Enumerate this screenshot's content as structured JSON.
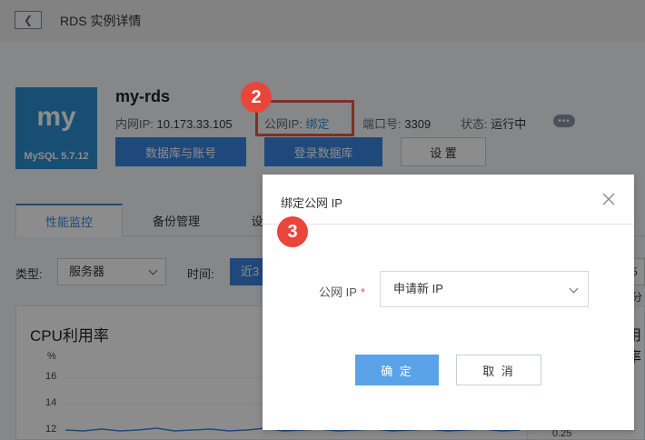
{
  "header": {
    "back_icon": "chevron-left-icon",
    "title": "RDS 实例详情"
  },
  "instance": {
    "logo_text": "my",
    "logo_version": "MySQL 5.7.12",
    "name": "my-rds",
    "intranet_label": "内网IP:",
    "intranet_value": "10.173.33.105",
    "public_label": "公网IP:",
    "public_link": "绑定",
    "port_label": "端口号:",
    "port_value": "3309",
    "status_label": "状态:",
    "status_value": "运行中",
    "more_icon": "more-dots-icon"
  },
  "actions": {
    "db_account": "数据库与账号",
    "login_db": "登录数据库",
    "settings": "设 置"
  },
  "tabs": [
    {
      "label": "性能监控"
    },
    {
      "label": "备份管理"
    },
    {
      "label": "设"
    }
  ],
  "filters": {
    "type_label": "类型:",
    "type_value": "服务器",
    "time_label": "时间:",
    "time_value": "近3",
    "right_stub": "5分"
  },
  "chart": {
    "title": "CPU利用率",
    "unit": "%",
    "y_ticks": [
      "16",
      "14",
      "12"
    ],
    "right_title": "用率",
    "right_tick": "0.25"
  },
  "annotations": {
    "step2": "2",
    "step3": "3",
    "highlight_color": "#e5574b"
  },
  "modal": {
    "title": "绑定公网 IP",
    "close_icon": "close-icon",
    "field_label": "公网 IP",
    "required_mark": "*",
    "select_value": "申请新 IP",
    "ok_label": "确 定",
    "cancel_label": "取 消"
  },
  "colors": {
    "primary": "#3a86e0",
    "logo_bg": "#2b8fd0",
    "ok_button": "#5aa3e8"
  }
}
